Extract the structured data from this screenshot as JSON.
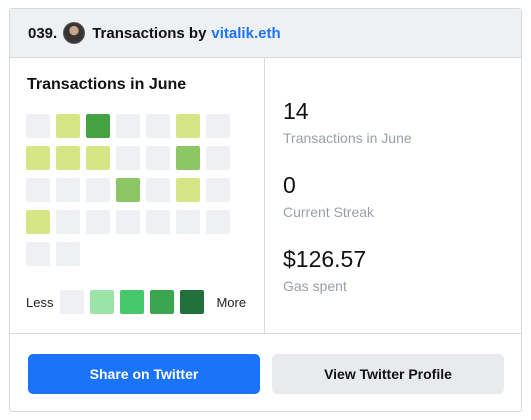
{
  "header": {
    "number": "039.",
    "title": "Transactions by",
    "link": "vitalik.eth"
  },
  "heatmap": {
    "title": "Transactions in June",
    "legend_less": "Less",
    "legend_more": "More",
    "legend_colors": [
      "#eef0f3",
      "#9be3a6",
      "#46c76a",
      "#3aa650",
      "#22703b"
    ],
    "levels_colors": [
      "#eef0f3",
      "#d6e685",
      "#8cc665",
      "#44a340"
    ],
    "cells": [
      [
        0,
        1,
        3,
        0,
        0,
        1,
        0
      ],
      [
        1,
        1,
        1,
        0,
        0,
        2,
        0
      ],
      [
        0,
        0,
        0,
        2,
        0,
        1,
        0
      ],
      [
        1,
        0,
        0,
        0,
        0,
        0,
        0
      ],
      [
        0,
        0
      ]
    ]
  },
  "stats": [
    {
      "value": "14",
      "label": "Transactions in June"
    },
    {
      "value": "0",
      "label": "Current Streak"
    },
    {
      "value": "$126.57",
      "label": "Gas spent"
    }
  ],
  "actions": {
    "share": "Share on Twitter",
    "view": "View Twitter Profile"
  }
}
